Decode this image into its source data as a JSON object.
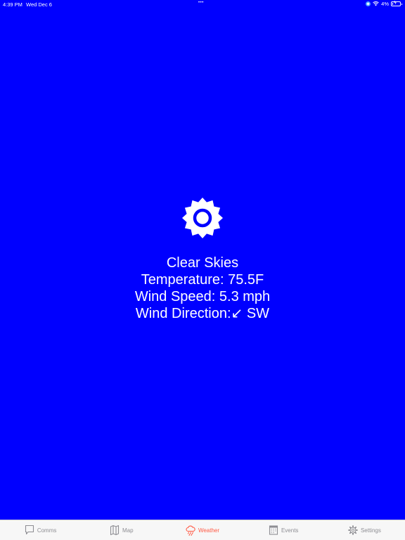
{
  "status_bar": {
    "time": "4:39 PM",
    "date": "Wed Dec 6",
    "dots": "•••",
    "battery": "4%"
  },
  "weather": {
    "condition": "Clear Skies",
    "temperature": "Temperature: 75.5F",
    "wind_speed": "Wind Speed: 5.3 mph",
    "wind_direction": "Wind Direction:↙ SW",
    "icon": "sun-icon"
  },
  "tabs": [
    {
      "label": "Comms",
      "icon": "chat-bubble-icon",
      "active": false
    },
    {
      "label": "Map",
      "icon": "map-icon",
      "active": false
    },
    {
      "label": "Weather",
      "icon": "cloud-rain-icon",
      "active": true
    },
    {
      "label": "Events",
      "icon": "calendar-icon",
      "active": false
    },
    {
      "label": "Settings",
      "icon": "gear-icon",
      "active": false
    }
  ],
  "colors": {
    "background": "#0000FF",
    "text": "#FFFFFF",
    "tab_active": "#FF5A45",
    "tab_inactive": "#8E8E93",
    "tab_bar_bg": "#F7F7F7"
  }
}
